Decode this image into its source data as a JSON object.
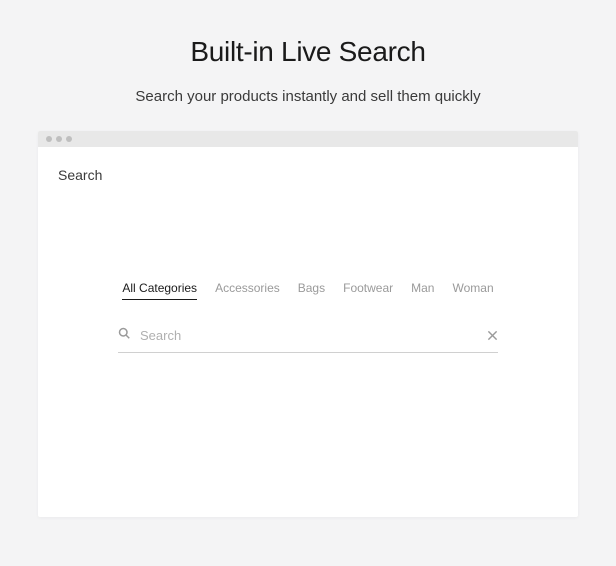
{
  "header": {
    "title": "Built-in Live Search",
    "subtitle": "Search your products instantly and sell them quickly"
  },
  "window": {
    "page_label": "Search",
    "categories": [
      {
        "label": "All Categories",
        "active": true
      },
      {
        "label": "Accessories",
        "active": false
      },
      {
        "label": "Bags",
        "active": false
      },
      {
        "label": "Footwear",
        "active": false
      },
      {
        "label": "Man",
        "active": false
      },
      {
        "label": "Woman",
        "active": false
      }
    ],
    "search": {
      "placeholder": "Search",
      "value": ""
    }
  }
}
